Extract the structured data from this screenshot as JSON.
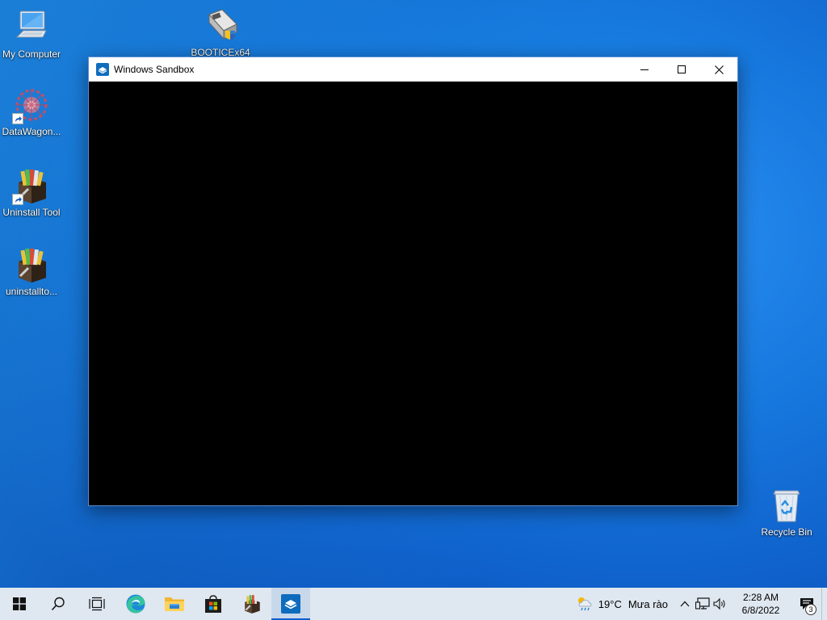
{
  "desktop": {
    "icons": [
      {
        "label": "My Computer",
        "icon": "computer-icon"
      },
      {
        "label": "BOOTICEx64",
        "icon": "booticex64-icon"
      },
      {
        "label": "DataWagon...",
        "icon": "datawagon-icon"
      },
      {
        "label": "Uninstall Tool",
        "icon": "uninstall-tool-icon"
      },
      {
        "label": "uninstallto...",
        "icon": "uninstall-tool-icon"
      },
      {
        "label": "Recycle Bin",
        "icon": "recycle-bin-icon"
      }
    ]
  },
  "window": {
    "title": "Windows Sandbox",
    "icon": "windows-sandbox-icon",
    "controls": [
      "minimize",
      "maximize",
      "close"
    ]
  },
  "taskbar": {
    "buttons": [
      "start",
      "search",
      "task-view",
      "edge",
      "file-explorer",
      "microsoft-store",
      "uninstall-tool",
      "windows-sandbox"
    ],
    "active": "windows-sandbox",
    "weather": {
      "temp": "19°C",
      "condition": "Mưa rào"
    },
    "clock": {
      "time": "2:28 AM",
      "date": "6/8/2022"
    },
    "notifications": "3"
  },
  "colors": {
    "accent": "#0a5fcf",
    "taskbar": "#dfe7f0",
    "desktop": "#1677dd"
  }
}
